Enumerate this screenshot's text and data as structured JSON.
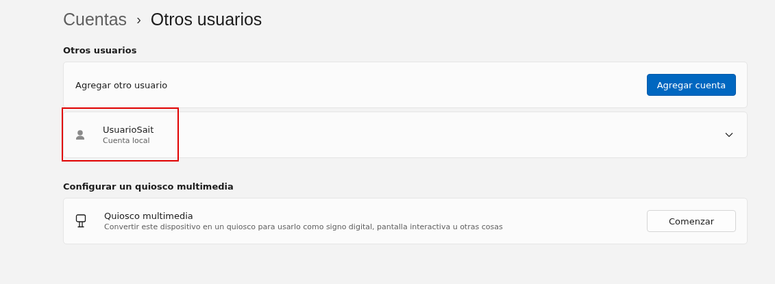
{
  "breadcrumb": {
    "parent": "Cuentas",
    "separator": "›",
    "current": "Otros usuarios"
  },
  "sections": [
    {
      "heading": "Otros usuarios",
      "cards": [
        {
          "kind": "action",
          "title": "Agregar otro usuario",
          "button": {
            "label": "Agregar cuenta",
            "kind": "primary"
          }
        },
        {
          "kind": "user",
          "title": "UsuarioSait",
          "subtitle": "Cuenta local",
          "expanded": false,
          "highlighted": true
        }
      ]
    },
    {
      "heading": "Configurar un quiosco multimedia",
      "cards": [
        {
          "kind": "kiosk",
          "title": "Quiosco multimedia",
          "subtitle": "Convertir este dispositivo en un quiosco para usarlo como signo digital, pantalla interactiva u otras cosas",
          "button": {
            "label": "Comenzar",
            "kind": "secondary"
          }
        }
      ]
    }
  ]
}
